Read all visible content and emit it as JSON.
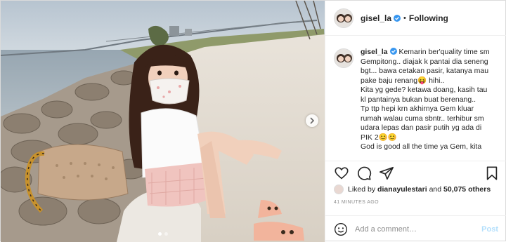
{
  "post": {
    "username": "gisel_la",
    "follow_status": "Following",
    "separator": "•",
    "caption_lines": [
      "Kemarin ber'quality time sm",
      "Gempitong.. diajak k pantai dia seneng",
      "bgt... bawa cetakan pasir, katanya mau",
      "pake baju renang😝 hihi..",
      "Kita yg gede? ketawa doang, kasih tau",
      "kl pantainya bukan buat berenang..",
      "Tp ttp hepi krn akhirnya Gem kluar",
      "rumah walau cuma sbntr.. terhibur sm",
      "udara lepas dan pasir putih yg ada di",
      "PIK 2😊😊",
      "God is good all the time ya Gem, kita"
    ],
    "likes_prefix": "Liked by",
    "liked_by_user": "dianayulestari",
    "likes_and": "and",
    "likes_count": "50,075 others",
    "timestamp": "41 MINUTES AGO",
    "comment_placeholder": "Add a comment…",
    "post_button": "Post",
    "carousel": {
      "slides": 2,
      "active": 1
    }
  },
  "icons": {
    "verified": "verified-badge-icon",
    "like": "heart-icon",
    "comment": "comment-icon",
    "share": "share-icon",
    "save": "bookmark-icon",
    "emoji": "emoji-icon",
    "next": "chevron-right-icon"
  },
  "colors": {
    "verified": "#3897f0",
    "text": "#262626",
    "muted": "#8e8e8e",
    "post_disabled": "#b2dffc",
    "border": "#dbdbdb"
  }
}
